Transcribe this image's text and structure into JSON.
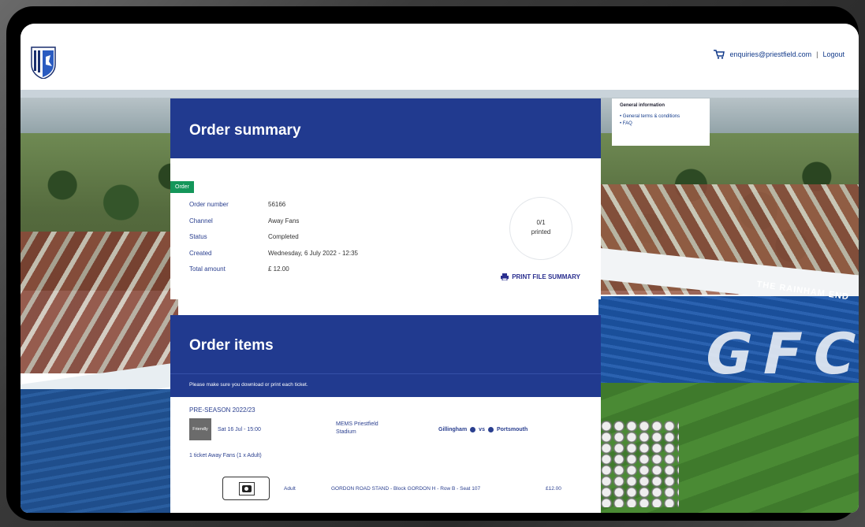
{
  "header": {
    "email": "enquiries@priestfield.com",
    "separator": "|",
    "logout_label": "Logout",
    "cart_icon": "cart-icon",
    "crest_icon": "club-crest-icon"
  },
  "info_card": {
    "title": "General information",
    "links": [
      "General terms & conditions",
      "FAQ"
    ]
  },
  "order_summary": {
    "title": "Order summary",
    "tag": "Order",
    "details": [
      {
        "label": "Order number",
        "value": "56166"
      },
      {
        "label": "Channel",
        "value": "Away Fans"
      },
      {
        "label": "Status",
        "value": "Completed"
      },
      {
        "label": "Created",
        "value": "Wednesday, 6 July 2022 - 12:35"
      },
      {
        "label": "Total amount",
        "value": "£ 12.00"
      }
    ],
    "printed_count": "0/1",
    "printed_label": "printed",
    "print_file_label": "PRINT FILE SUMMARY"
  },
  "order_items": {
    "title": "Order items",
    "notice": "Please make sure you download or print each ticket.",
    "season": "PRE-SEASON 2022/23",
    "match": {
      "type": "Friendly",
      "date": "Sat 16 Jul - 15:00",
      "venue": "MEMS Priestfield Stadium",
      "home": "Gillingham",
      "vs": "vs",
      "away": "Portsmouth"
    },
    "ticket_heading": "1 ticket Away Fans (1 x Adult)",
    "ticket": {
      "type": "Adult",
      "seat": "GORDON ROAD STAND - Block GORDON H - Row B - Seat 107",
      "price": "£12.00"
    }
  },
  "stadium_sign": "THE RAINHAM END",
  "stadium_seats_text": "GFC",
  "colors": {
    "brand_blue": "#213a8f",
    "order_tag_green": "#14965a"
  }
}
